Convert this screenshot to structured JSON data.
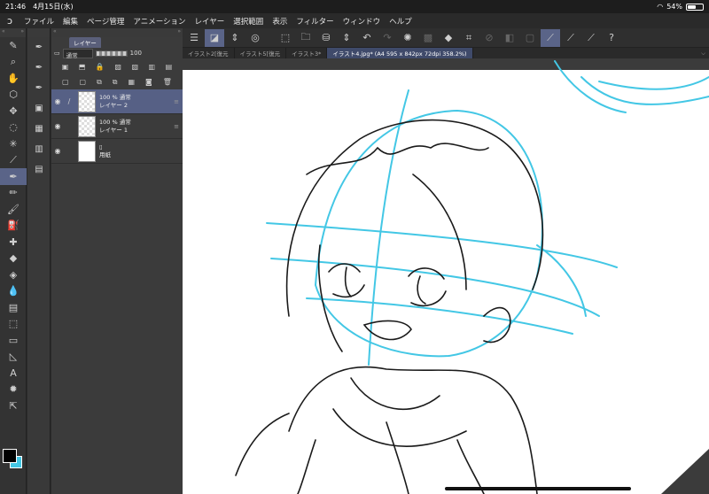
{
  "status": {
    "time": "21:46",
    "date": "4月15日(水)",
    "battery": "54%",
    "battery_level": 0.54
  },
  "menu": [
    "ファイル",
    "編集",
    "ページ管理",
    "アニメーション",
    "レイヤー",
    "選択範囲",
    "表示",
    "フィルター",
    "ウィンドウ",
    "ヘルプ"
  ],
  "layer_panel": {
    "tab": "レイヤー",
    "blend_mode": "通常",
    "opacity": "100",
    "layers": [
      {
        "opacity_mode": "100 % 通常",
        "name": "レイヤー 2",
        "selected": true
      },
      {
        "opacity_mode": "100 % 通常",
        "name": "レイヤー 1",
        "selected": false
      },
      {
        "opacity_mode": "",
        "name": "用紙",
        "selected": false
      }
    ]
  },
  "doc_tabs": [
    "イラスト2[復元",
    "イラスト5[復元",
    "イラスト3*",
    "イラスト4.jpg* (A4 595 x 842px 72dpi 358.2%)"
  ],
  "colors": {
    "accent": "#5a6488",
    "sketch_blue": "#43c7e5",
    "main_color": "#000000",
    "sub_color": "#43c7e5"
  }
}
